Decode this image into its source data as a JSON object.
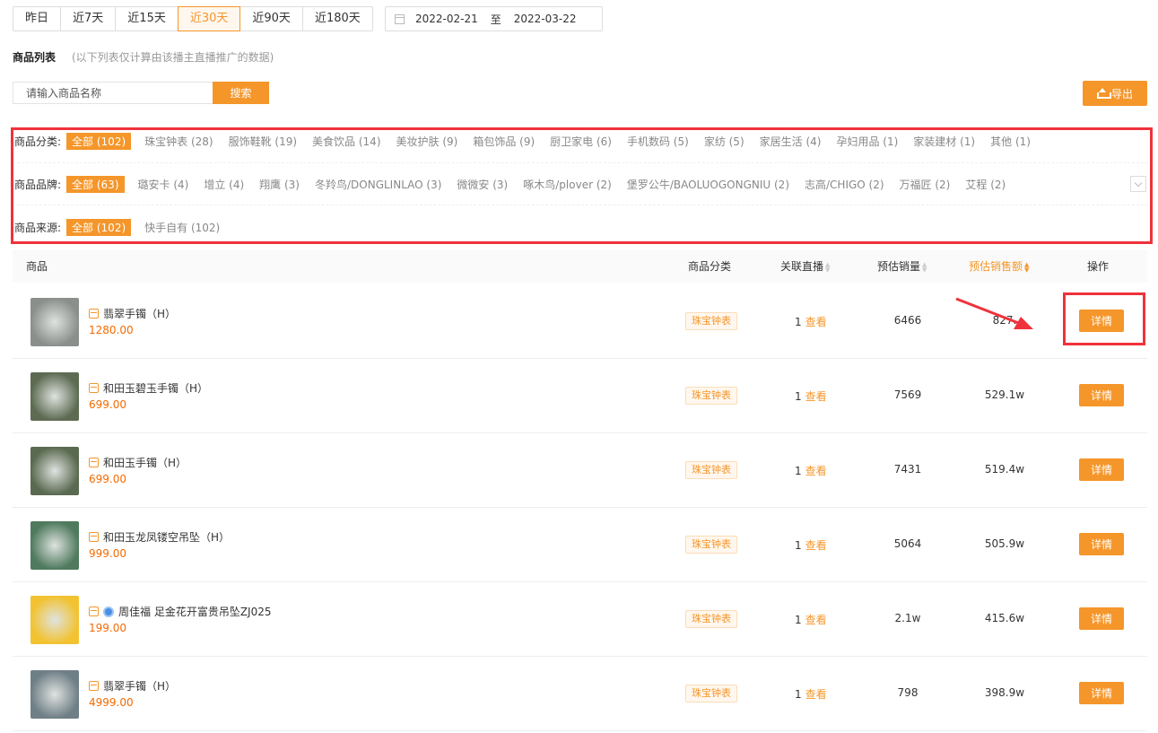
{
  "date_tabs": [
    "昨日",
    "近7天",
    "近15天",
    "近30天",
    "近90天",
    "近180天"
  ],
  "active_date_tab": "近30天",
  "date_range": {
    "start": "2022-02-21",
    "separator": "至",
    "end": "2022-03-22"
  },
  "section": {
    "title": "商品列表",
    "note": "(以下列表仅计算由该播主直播推广的数据)"
  },
  "search": {
    "placeholder": "请输入商品名称",
    "button": "搜索"
  },
  "export_label": "导出",
  "filters": {
    "category": {
      "label": "商品分类:",
      "options": [
        "全部 (102)",
        "珠宝钟表 (28)",
        "服饰鞋靴 (19)",
        "美食饮品 (14)",
        "美妆护肤 (9)",
        "箱包饰品 (9)",
        "厨卫家电 (6)",
        "手机数码 (5)",
        "家纺 (5)",
        "家居生活 (4)",
        "孕妇用品 (1)",
        "家装建材 (1)",
        "其他 (1)"
      ]
    },
    "brand": {
      "label": "商品品牌:",
      "options": [
        "全部 (63)",
        "璐安卡 (4)",
        "增立 (4)",
        "翔鹰 (3)",
        "冬羚鸟/DONGLINLAO (3)",
        "微微安 (3)",
        "啄木鸟/plover (2)",
        "堡罗公牛/BAOLUOGONGNIU (2)",
        "志高/CHIGO (2)",
        "万福匠 (2)",
        "艾程 (2)"
      ]
    },
    "source": {
      "label": "商品来源:",
      "options": [
        "全部 (102)",
        "快手自有 (102)"
      ]
    }
  },
  "table": {
    "headers": {
      "product": "商品",
      "category": "商品分类",
      "live": "关联直播",
      "sales": "预估销量",
      "amount": "预估销售额",
      "action": "操作"
    },
    "view_label": "查看",
    "detail_label": "详情",
    "rows": [
      {
        "name": "翡翠手镯（H）",
        "price": "1280.00",
        "category": "珠宝钟表",
        "live_count": "1",
        "sales": "6466",
        "amount": "827.",
        "thumb_color": "#8a8f8c",
        "badge": false
      },
      {
        "name": "和田玉碧玉手镯（H）",
        "price": "699.00",
        "category": "珠宝钟表",
        "live_count": "1",
        "sales": "7569",
        "amount": "529.1w",
        "thumb_color": "#5d6b52",
        "badge": false
      },
      {
        "name": "和田玉手镯（H）",
        "price": "699.00",
        "category": "珠宝钟表",
        "live_count": "1",
        "sales": "7431",
        "amount": "519.4w",
        "thumb_color": "#5a6a50",
        "badge": false
      },
      {
        "name": "和田玉龙凤镂空吊坠（H）",
        "price": "999.00",
        "category": "珠宝钟表",
        "live_count": "1",
        "sales": "5064",
        "amount": "505.9w",
        "thumb_color": "#4f7a5e",
        "badge": false
      },
      {
        "name": "周佳福 足金花开富贵吊坠ZJ025",
        "price": "199.00",
        "category": "珠宝钟表",
        "live_count": "1",
        "sales": "2.1w",
        "amount": "415.6w",
        "thumb_color": "#f2c230",
        "badge": true
      },
      {
        "name": "翡翠手镯（H）",
        "price": "4999.00",
        "category": "珠宝钟表",
        "live_count": "1",
        "sales": "798",
        "amount": "398.9w",
        "thumb_color": "#6f7f86",
        "badge": false
      }
    ]
  },
  "colors": {
    "accent": "#f5962a",
    "highlight_border": "#f0323b",
    "price": "#f56a00"
  }
}
